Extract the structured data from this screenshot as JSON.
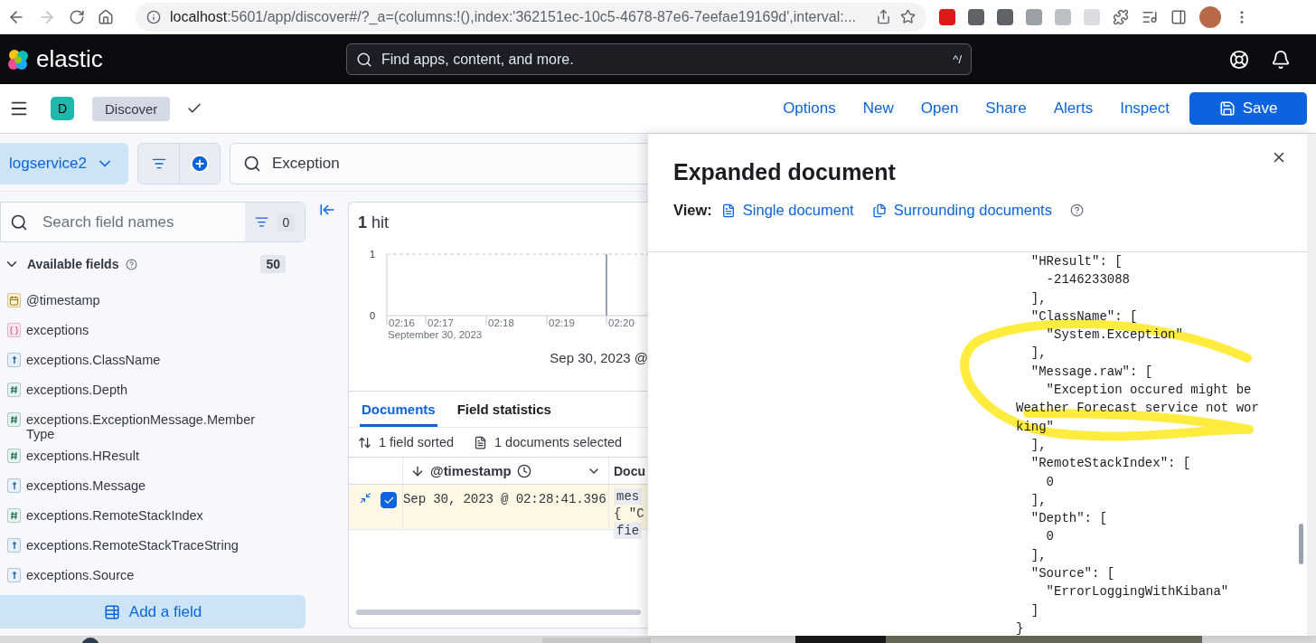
{
  "browser": {
    "url_host": "localhost",
    "url_rest": ":5601/app/discover#/?_a=(columns:!(),index:'362151ec-10c5-4678-87e6-7eefae19169d',interval:..."
  },
  "header": {
    "brand": "elastic",
    "search_placeholder": "Find apps, content, and more.",
    "shortcut": "^/"
  },
  "breadcrumb": {
    "avatar": "D",
    "app": "Discover"
  },
  "top_menu": [
    "Options",
    "New",
    "Open",
    "Share",
    "Alerts",
    "Inspect"
  ],
  "save_button": "Save",
  "data_view": "logservice2",
  "query": "Exception",
  "field_search": {
    "placeholder": "Search field names",
    "filter_count": "0"
  },
  "available_fields": {
    "label": "Available fields",
    "count": "50",
    "expanded": true,
    "fields": [
      {
        "name": "@timestamp",
        "kind": "date"
      },
      {
        "name": "exceptions",
        "kind": "nested"
      },
      {
        "name": "exceptions.ClassName",
        "kind": "string"
      },
      {
        "name": "exceptions.Depth",
        "kind": "number"
      },
      {
        "name": "exceptions.ExceptionMessage.MemberType",
        "kind": "number"
      },
      {
        "name": "exceptions.HResult",
        "kind": "number"
      },
      {
        "name": "exceptions.Message",
        "kind": "string"
      },
      {
        "name": "exceptions.RemoteStackIndex",
        "kind": "number"
      },
      {
        "name": "exceptions.RemoteStackTraceString",
        "kind": "string"
      },
      {
        "name": "exceptions.Source",
        "kind": "string"
      }
    ]
  },
  "add_field": "Add a field",
  "hits": {
    "count": "1",
    "label": "hit"
  },
  "histogram": {
    "date_label": "September 30, 2023",
    "chart_data": {
      "type": "bar",
      "categories": [
        "02:16",
        "02:17",
        "02:18",
        "02:19",
        "02:20"
      ],
      "values": [
        0,
        0,
        0,
        0,
        1
      ],
      "ylim": [
        0,
        1
      ],
      "yticks": [
        0,
        1
      ]
    }
  },
  "range_label": "Sep 30, 2023 @",
  "tabs": [
    {
      "label": "Documents",
      "selected": true
    },
    {
      "label": "Field statistics",
      "selected": false
    }
  ],
  "grid_toolbar": {
    "sorted": "1 field sorted",
    "selected": "1 documents selected"
  },
  "grid": {
    "columns": [
      "@timestamp",
      "Docu"
    ],
    "rows": [
      {
        "selected": true,
        "timestamp": "Sep 30, 2023 @ 02:28:41.396",
        "document": [
          {
            "text": "mes",
            "kind": "key"
          },
          {
            "text": "{ \"C",
            "kind": "text"
          },
          {
            "text": "fie",
            "kind": "key"
          }
        ]
      }
    ]
  },
  "flyout": {
    "title": "Expanded document",
    "view_label": "View:",
    "views": [
      "Single document",
      "Surrounding documents"
    ],
    "code_lines": [
      "  \"HResult\": [",
      "    -2146233088",
      "  ],",
      "  \"ClassName\": [",
      "    \"System.Exception\"",
      "  ],",
      "  \"Message.raw\": [",
      "    \"Exception occured might be",
      "Weather Forecast service not wor",
      "king\"",
      "  ],",
      "  \"RemoteStackIndex\": [",
      "    0",
      "  ],",
      "  \"Depth\": [",
      "    0",
      "  ],",
      "  \"Source\": [",
      "    \"ErrorLoggingWithKibana\"",
      "  ]",
      "}"
    ]
  }
}
